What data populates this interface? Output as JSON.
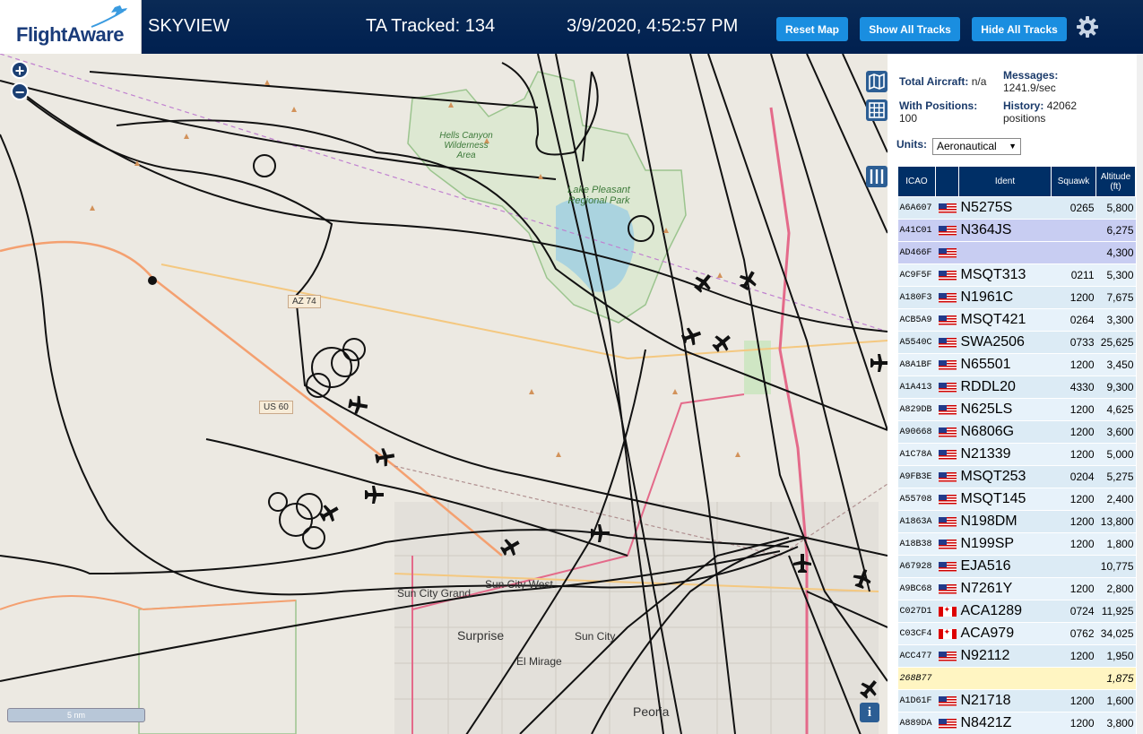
{
  "header": {
    "logo_text": "FlightAware",
    "site_name": "SKYVIEW",
    "tracked_label": "TA Tracked: 134",
    "datetime": "3/9/2020, 4:52:57 PM",
    "reset_map": "Reset Map",
    "show_all_tracks": "Show All Tracks",
    "hide_all_tracks": "Hide All Tracks",
    "settings_icon": "gear-icon"
  },
  "map": {
    "zoom_in": "+",
    "zoom_out": "−",
    "scale_label": "5 nm",
    "info": "i",
    "labels": {
      "hells_canyon": "Hells Canyon Wilderness Area",
      "lake_pleasant": "Lake Pleasant Regional Park",
      "az74": "AZ 74",
      "us60": "US 60",
      "sun_city_grand": "Sun City Grand",
      "sun_city_west": "Sun City West",
      "surprise": "Surprise",
      "sun_city": "Sun City",
      "el_mirage": "El Mirage",
      "peoria": "Peoria"
    },
    "controls": [
      "map-icon",
      "grid-icon",
      "columns-icon"
    ]
  },
  "panel": {
    "total_aircraft_label": "Total Aircraft:",
    "total_aircraft_value": "n/a",
    "with_positions_label": "With Positions:",
    "with_positions_value": "100",
    "messages_label": "Messages:",
    "messages_value": "1241.9/sec",
    "history_label": "History:",
    "history_value": "42062 positions",
    "units_label": "Units:",
    "units_value": "Aeronautical"
  },
  "table": {
    "headers": [
      "ICAO",
      "",
      "Ident",
      "Squawk",
      "Altitude (ft)"
    ],
    "rows": [
      {
        "icao": "A6A607",
        "flag": "us",
        "ident": "N5275S",
        "squawk": "0265",
        "alt": "5,800"
      },
      {
        "icao": "A41C01",
        "flag": "us",
        "ident": "N364JS",
        "squawk": "",
        "alt": "6,275"
      },
      {
        "icao": "AD466F",
        "flag": "us",
        "ident": "",
        "squawk": "",
        "alt": "4,300"
      },
      {
        "icao": "AC9F5F",
        "flag": "us",
        "ident": "MSQT313",
        "squawk": "0211",
        "alt": "5,300"
      },
      {
        "icao": "A180F3",
        "flag": "us",
        "ident": "N1961C",
        "squawk": "1200",
        "alt": "7,675"
      },
      {
        "icao": "ACB5A9",
        "flag": "us",
        "ident": "MSQT421",
        "squawk": "0264",
        "alt": "3,300"
      },
      {
        "icao": "A5540C",
        "flag": "us",
        "ident": "SWA2506",
        "squawk": "0733",
        "alt": "25,625"
      },
      {
        "icao": "A8A1BF",
        "flag": "us",
        "ident": "N65501",
        "squawk": "1200",
        "alt": "3,450"
      },
      {
        "icao": "A1A413",
        "flag": "us",
        "ident": "RDDL20",
        "squawk": "4330",
        "alt": "9,300"
      },
      {
        "icao": "A829DB",
        "flag": "us",
        "ident": "N625LS",
        "squawk": "1200",
        "alt": "4,625"
      },
      {
        "icao": "A90668",
        "flag": "us",
        "ident": "N6806G",
        "squawk": "1200",
        "alt": "3,600"
      },
      {
        "icao": "A1C78A",
        "flag": "us",
        "ident": "N21339",
        "squawk": "1200",
        "alt": "5,000"
      },
      {
        "icao": "A9FB3E",
        "flag": "us",
        "ident": "MSQT253",
        "squawk": "0204",
        "alt": "5,275"
      },
      {
        "icao": "A55708",
        "flag": "us",
        "ident": "MSQT145",
        "squawk": "1200",
        "alt": "2,400"
      },
      {
        "icao": "A1863A",
        "flag": "us",
        "ident": "N198DM",
        "squawk": "1200",
        "alt": "13,800"
      },
      {
        "icao": "A18B38",
        "flag": "us",
        "ident": "N199SP",
        "squawk": "1200",
        "alt": "1,800"
      },
      {
        "icao": "A67928",
        "flag": "us",
        "ident": "EJA516",
        "squawk": "",
        "alt": "10,775"
      },
      {
        "icao": "A9BC68",
        "flag": "us",
        "ident": "N7261Y",
        "squawk": "1200",
        "alt": "2,800"
      },
      {
        "icao": "C027D1",
        "flag": "ca",
        "ident": "ACA1289",
        "squawk": "0724",
        "alt": "11,925"
      },
      {
        "icao": "C03CF4",
        "flag": "ca",
        "ident": "ACA979",
        "squawk": "0762",
        "alt": "34,025"
      },
      {
        "icao": "ACC477",
        "flag": "us",
        "ident": "N92112",
        "squawk": "1200",
        "alt": "1,950"
      },
      {
        "icao": "268B77",
        "flag": "",
        "ident": "",
        "squawk": "",
        "alt": "1,875",
        "style": "yel"
      },
      {
        "icao": "A1D61F",
        "flag": "us",
        "ident": "N21718",
        "squawk": "1200",
        "alt": "1,600"
      },
      {
        "icao": "A889DA",
        "flag": "us",
        "ident": "N8421Z",
        "squawk": "1200",
        "alt": "3,800"
      }
    ]
  },
  "colors": {
    "header_bg": "#002050",
    "button": "#1a8ee0",
    "table_header": "#002f66",
    "row_selected": "#c8cdf2"
  }
}
